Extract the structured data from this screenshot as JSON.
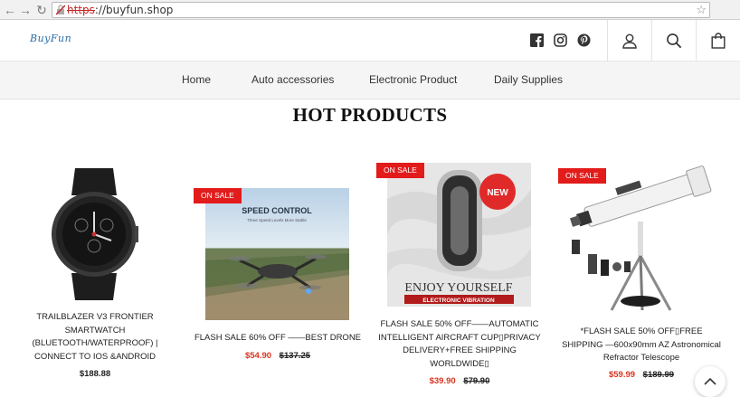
{
  "browser": {
    "url_scheme": "https",
    "url_rest": "://buyfun.shop"
  },
  "header": {
    "logo": "BuyFun",
    "social": [
      "facebook-icon",
      "instagram-icon",
      "pinterest-icon"
    ],
    "actions": [
      "account-icon",
      "search-icon",
      "cart-icon"
    ]
  },
  "nav": {
    "items": [
      "Home",
      "Auto accessories",
      "Electronic Product",
      "Daily Supplies"
    ]
  },
  "section": {
    "title": "HOT PRODUCTS"
  },
  "products": [
    {
      "badge": "",
      "title": "TRAILBLAZER V3 FRONTIER SMARTWATCH (BLUETOOTH/WATERPROOF) | CONNECT TO IOS &ANDROID",
      "sale_price": "",
      "old_price": "",
      "price": "$188.88"
    },
    {
      "badge": "ON SALE",
      "title": "FLASH SALE 60% OFF ——BEST DRONE",
      "image_text_top": "SPEED CONTROL",
      "image_text_sub": "Three Speed Levels  More Stable",
      "sale_price": "$54.90",
      "old_price": "$137.25",
      "price": ""
    },
    {
      "badge": "ON SALE",
      "title": "FLASH SALE 50% OFF——AUTOMATIC INTELLIGENT AIRCRAFT CUP▯PRIVACY DELIVERY+FREE SHIPPING WORLDWIDE▯",
      "image_new": "NEW",
      "image_text_main": "ENJOY YOURSELF",
      "image_text_sub": "ELECTRONIC VIBRATION",
      "sale_price": "$39.90",
      "old_price": "$79.90",
      "price": ""
    },
    {
      "badge": "ON SALE",
      "title": "*FLASH SALE 50% OFF▯FREE SHIPPING —600x90mm AZ Astronomical Refractor Telescope",
      "sale_price": "$59.99",
      "old_price": "$189.99",
      "price": ""
    }
  ],
  "colors": {
    "badge": "#e21b1b",
    "sale_price": "#d9341f",
    "logo": "#2a6ea8"
  }
}
